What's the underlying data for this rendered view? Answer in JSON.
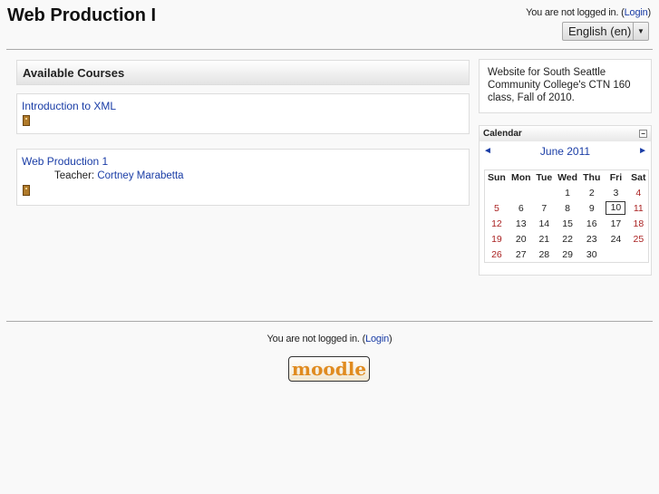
{
  "header": {
    "site_title": "Web Production I",
    "login_text": "You are not logged in. (",
    "login_link": "Login",
    "login_close": ")",
    "language": "English (en)"
  },
  "main": {
    "heading": "Available Courses",
    "courses": [
      {
        "name": "Introduction to XML"
      },
      {
        "name": "Web Production 1",
        "teacher_label": "Teacher:",
        "teacher_name": "Cortney Marabetta"
      }
    ]
  },
  "sidebar": {
    "summary": "Website for South Seattle Community College's CTN 160 class, Fall of 2010.",
    "calendar": {
      "title": "Calendar",
      "month": "June 2011",
      "prev": "◄",
      "next": "►",
      "weekdays": [
        "Sun",
        "Mon",
        "Tue",
        "Wed",
        "Thu",
        "Fri",
        "Sat"
      ],
      "weeks": [
        [
          "",
          "",
          "",
          "1",
          "2",
          "3",
          "4"
        ],
        [
          "5",
          "6",
          "7",
          "8",
          "9",
          "10",
          "11"
        ],
        [
          "12",
          "13",
          "14",
          "15",
          "16",
          "17",
          "18"
        ],
        [
          "19",
          "20",
          "21",
          "22",
          "23",
          "24",
          "25"
        ],
        [
          "26",
          "27",
          "28",
          "29",
          "30",
          "",
          ""
        ]
      ],
      "today": "10"
    }
  },
  "footer": {
    "login_text": "You are not logged in. (",
    "login_link": "Login",
    "login_close": ")",
    "logo_text": "moodle"
  },
  "colors": {
    "link": "#1a3da6",
    "weekend": "#a22222",
    "logo": "#e08b1f"
  }
}
